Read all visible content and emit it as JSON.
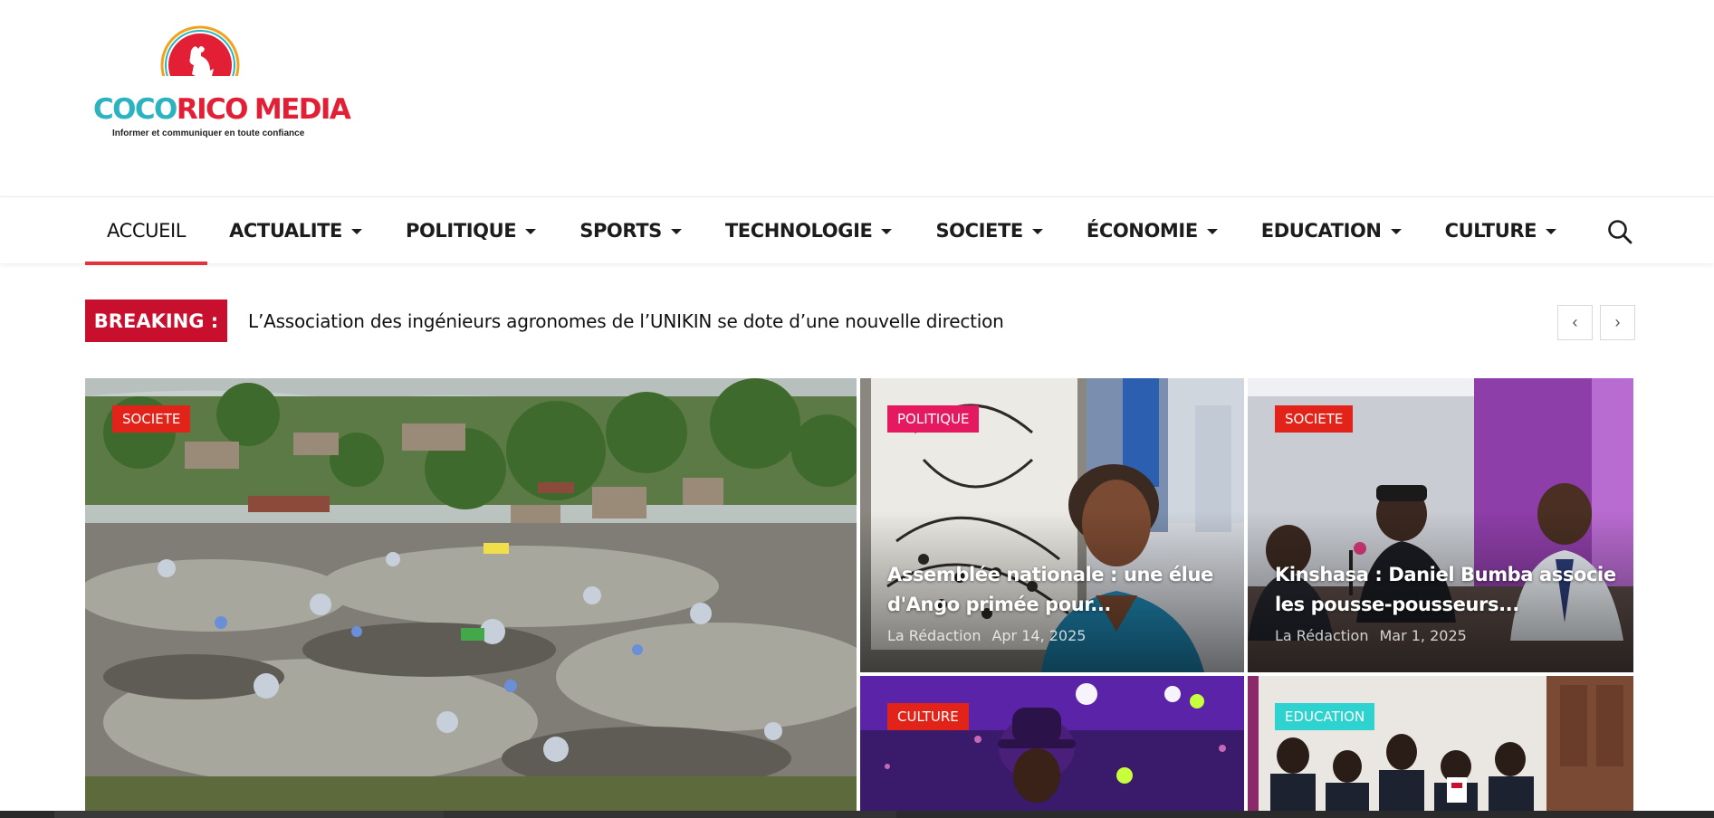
{
  "site": {
    "logo_word_1": "COCO",
    "logo_word_2": "RICO",
    "logo_word_3": "MEDIA",
    "tagline": "Informer et communiquer en toute  confiance",
    "brand_colors": {
      "teal": "#2bb3c0",
      "red": "#e21f35",
      "orange": "#f4a21a"
    }
  },
  "nav": {
    "items": [
      {
        "label": "ACCUEIL",
        "active": true,
        "has_dropdown": false
      },
      {
        "label": "ACTUALITE",
        "active": false,
        "has_dropdown": true
      },
      {
        "label": "POLITIQUE",
        "active": false,
        "has_dropdown": true
      },
      {
        "label": "SPORTS",
        "active": false,
        "has_dropdown": true
      },
      {
        "label": "TECHNOLOGIE",
        "active": false,
        "has_dropdown": true
      },
      {
        "label": "SOCIETE",
        "active": false,
        "has_dropdown": true
      },
      {
        "label": "ÉCONOMIE",
        "active": false,
        "has_dropdown": true
      },
      {
        "label": "EDUCATION",
        "active": false,
        "has_dropdown": true
      },
      {
        "label": "CULTURE",
        "active": false,
        "has_dropdown": true
      }
    ],
    "search_icon": "search-icon",
    "active_underline_color": "#e2333a"
  },
  "breaking": {
    "label": "BREAKING :",
    "headline": "L’Association des ingénieurs agronomes de l’UNIKIN se dote d’une nouvelle direction",
    "label_color": "#c8102e",
    "prev_icon": "chevron-left-icon",
    "next_icon": "chevron-right-icon",
    "prev_glyph": "‹",
    "next_glyph": "›"
  },
  "cards": [
    {
      "category": "SOCIETE",
      "category_color": "#e2231a",
      "title_line1": "",
      "title_line2": "",
      "author": "",
      "date": ""
    },
    {
      "category": "POLITIQUE",
      "category_color": "#e5195f",
      "title_line1": "Assemblée nationale : une élue",
      "title_line2": "d'Ango primée pour...",
      "author": "La Rédaction",
      "date": "Apr 14, 2025"
    },
    {
      "category": "SOCIETE",
      "category_color": "#e2231a",
      "title_line1": "Kinshasa : Daniel Bumba associe",
      "title_line2": "les pousse-pousseurs...",
      "author": "La Rédaction",
      "date": "Mar 1, 2025"
    },
    {
      "category": "CULTURE",
      "category_color": "#e2231a",
      "title_line1": "",
      "title_line2": "",
      "author": "",
      "date": ""
    },
    {
      "category": "EDUCATION",
      "category_color": "#2ed3d0",
      "title_line1": "",
      "title_line2": "",
      "author": "",
      "date": ""
    }
  ]
}
